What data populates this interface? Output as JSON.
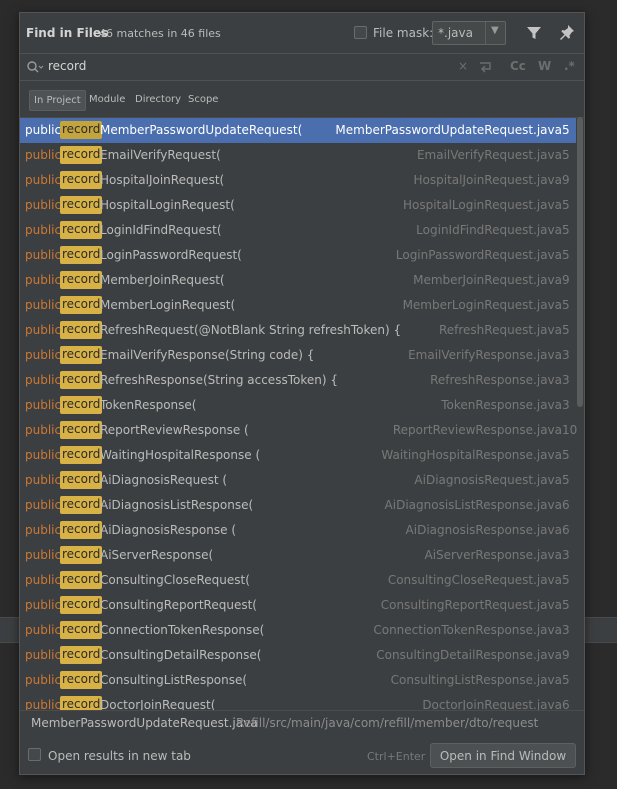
{
  "header": {
    "title": "Find in Files",
    "match_count": "46 matches in 46 files",
    "file_mask_label": "File mask:",
    "file_mask_value": "*.java",
    "file_mask_checked": false
  },
  "search": {
    "query": "record",
    "options": [
      "Cc",
      "W",
      ".*"
    ]
  },
  "scopes": [
    {
      "label": "In Project",
      "active": true
    },
    {
      "label": "Module",
      "active": false
    },
    {
      "label": "Directory",
      "active": false
    },
    {
      "label": "Scope",
      "active": false
    }
  ],
  "results": [
    {
      "keyword": "public",
      "match": "record",
      "code": "MemberPasswordUpdateRequest(",
      "file": "MemberPasswordUpdateRequest.java",
      "line": "5",
      "selected": true
    },
    {
      "keyword": "public",
      "match": "record",
      "code": "EmailVerifyRequest(",
      "file": "EmailVerifyRequest.java",
      "line": "5"
    },
    {
      "keyword": "public",
      "match": "record",
      "code": "HospitalJoinRequest(",
      "file": "HospitalJoinRequest.java",
      "line": "9"
    },
    {
      "keyword": "public",
      "match": "record",
      "code": "HospitalLoginRequest(",
      "file": "HospitalLoginRequest.java",
      "line": "5"
    },
    {
      "keyword": "public",
      "match": "record",
      "code": "LoginIdFindRequest(",
      "file": "LoginIdFindRequest.java",
      "line": "5"
    },
    {
      "keyword": "public",
      "match": "record",
      "code": "LoginPasswordRequest(",
      "file": "LoginPasswordRequest.java",
      "line": "5"
    },
    {
      "keyword": "public",
      "match": "record",
      "code": "MemberJoinRequest(",
      "file": "MemberJoinRequest.java",
      "line": "9"
    },
    {
      "keyword": "public",
      "match": "record",
      "code": "MemberLoginRequest(",
      "file": "MemberLoginRequest.java",
      "line": "5"
    },
    {
      "keyword": "public",
      "match": "record",
      "code": "RefreshRequest(@NotBlank String refreshToken) {",
      "file": "RefreshRequest.java",
      "line": "5"
    },
    {
      "keyword": "public",
      "match": "record",
      "code": "EmailVerifyResponse(String code) {",
      "file": "EmailVerifyResponse.java",
      "line": "3"
    },
    {
      "keyword": "public",
      "match": "record",
      "code": "RefreshResponse(String accessToken) {",
      "file": "RefreshResponse.java",
      "line": "3"
    },
    {
      "keyword": "public",
      "match": "record",
      "code": "TokenResponse(",
      "file": "TokenResponse.java",
      "line": "3"
    },
    {
      "keyword": "public",
      "match": "record",
      "code": "ReportReviewResponse (",
      "file": "ReportReviewResponse.java",
      "line": "10"
    },
    {
      "keyword": "public",
      "match": "record",
      "code": "WaitingHospitalResponse (",
      "file": "WaitingHospitalResponse.java",
      "line": "5"
    },
    {
      "keyword": "public",
      "match": "record",
      "code": "AiDiagnosisRequest (",
      "file": "AiDiagnosisRequest.java",
      "line": "5"
    },
    {
      "keyword": "public",
      "match": "record",
      "code": "AiDiagnosisListResponse(",
      "file": "AiDiagnosisListResponse.java",
      "line": "6"
    },
    {
      "keyword": "public",
      "match": "record",
      "code": "AiDiagnosisResponse (",
      "file": "AiDiagnosisResponse.java",
      "line": "6"
    },
    {
      "keyword": "public",
      "match": "record",
      "code": "AiServerResponse(",
      "file": "AiServerResponse.java",
      "line": "3"
    },
    {
      "keyword": "public",
      "match": "record",
      "code": "ConsultingCloseRequest(",
      "file": "ConsultingCloseRequest.java",
      "line": "5"
    },
    {
      "keyword": "public",
      "match": "record",
      "code": "ConsultingReportRequest(",
      "file": "ConsultingReportRequest.java",
      "line": "5"
    },
    {
      "keyword": "public",
      "match": "record",
      "code": "ConnectionTokenResponse(",
      "file": "ConnectionTokenResponse.java",
      "line": "3"
    },
    {
      "keyword": "public",
      "match": "record",
      "code": "ConsultingDetailResponse(",
      "file": "ConsultingDetailResponse.java",
      "line": "9"
    },
    {
      "keyword": "public",
      "match": "record",
      "code": "ConsultingListResponse(",
      "file": "ConsultingListResponse.java",
      "line": "5"
    },
    {
      "keyword": "public",
      "match": "record",
      "code": "DoctorJoinRequest(",
      "file": "DoctorJoinRequest.java",
      "line": "6"
    }
  ],
  "preview": {
    "file": "MemberPasswordUpdateRequest.java",
    "path": "Refill/src/main/java/com/refill/member/dto/request"
  },
  "footer": {
    "new_tab_label": "Open results in new tab",
    "new_tab_checked": false,
    "shortcut": "Ctrl+Enter",
    "open_button_label": "Open in Find Window"
  },
  "icons": {
    "filter": "filter-icon",
    "pin": "pin-icon",
    "search": "search-icon",
    "clear": "close-icon",
    "newline": "newline-icon"
  },
  "colors": {
    "selection": "#4b6eaf",
    "keyword": "#cc7832",
    "highlight": "#d8b245"
  }
}
